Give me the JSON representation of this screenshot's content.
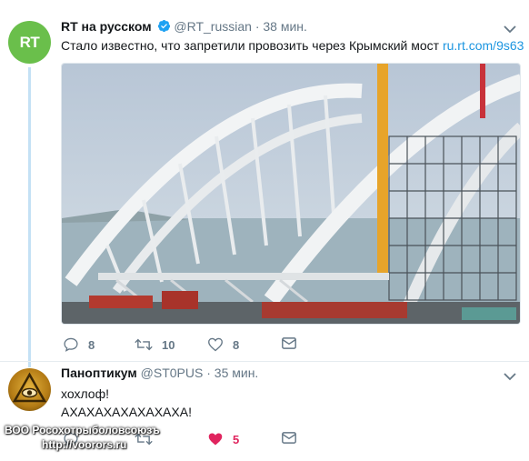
{
  "tweets": [
    {
      "avatar_text": "RT",
      "name": "RT на русском",
      "verified": true,
      "handle": "@RT_russian",
      "separator": "·",
      "time": "38 мин.",
      "text": "Стало известно, что запретили провозить через Крымский мост",
      "link": "ru.rt.com/9s63",
      "photo_icon": "bridge-arch-construction-photo",
      "actions": {
        "replies": "8",
        "retweets": "10",
        "likes": "8"
      }
    },
    {
      "avatar_icon": "eye-of-providence-icon",
      "name": "Паноптикум",
      "handle": "@ST0PUS",
      "separator": "·",
      "time": "35 мин.",
      "text_line1": "хохлоф!",
      "text_line2": "АХАХАХАХАХАХАХА!",
      "actions": {
        "replies": "",
        "retweets": "",
        "likes": "5",
        "liked": true
      }
    }
  ],
  "watermark": {
    "line1": "ВОО Росохотрыболовсоюзъ",
    "line2": "http://voorors.ru"
  },
  "colors": {
    "accent": "#1b95e0",
    "muted": "#657786",
    "like_active": "#e0245e",
    "rt_green": "#6abf4b",
    "thread": "#c4e1f5"
  }
}
